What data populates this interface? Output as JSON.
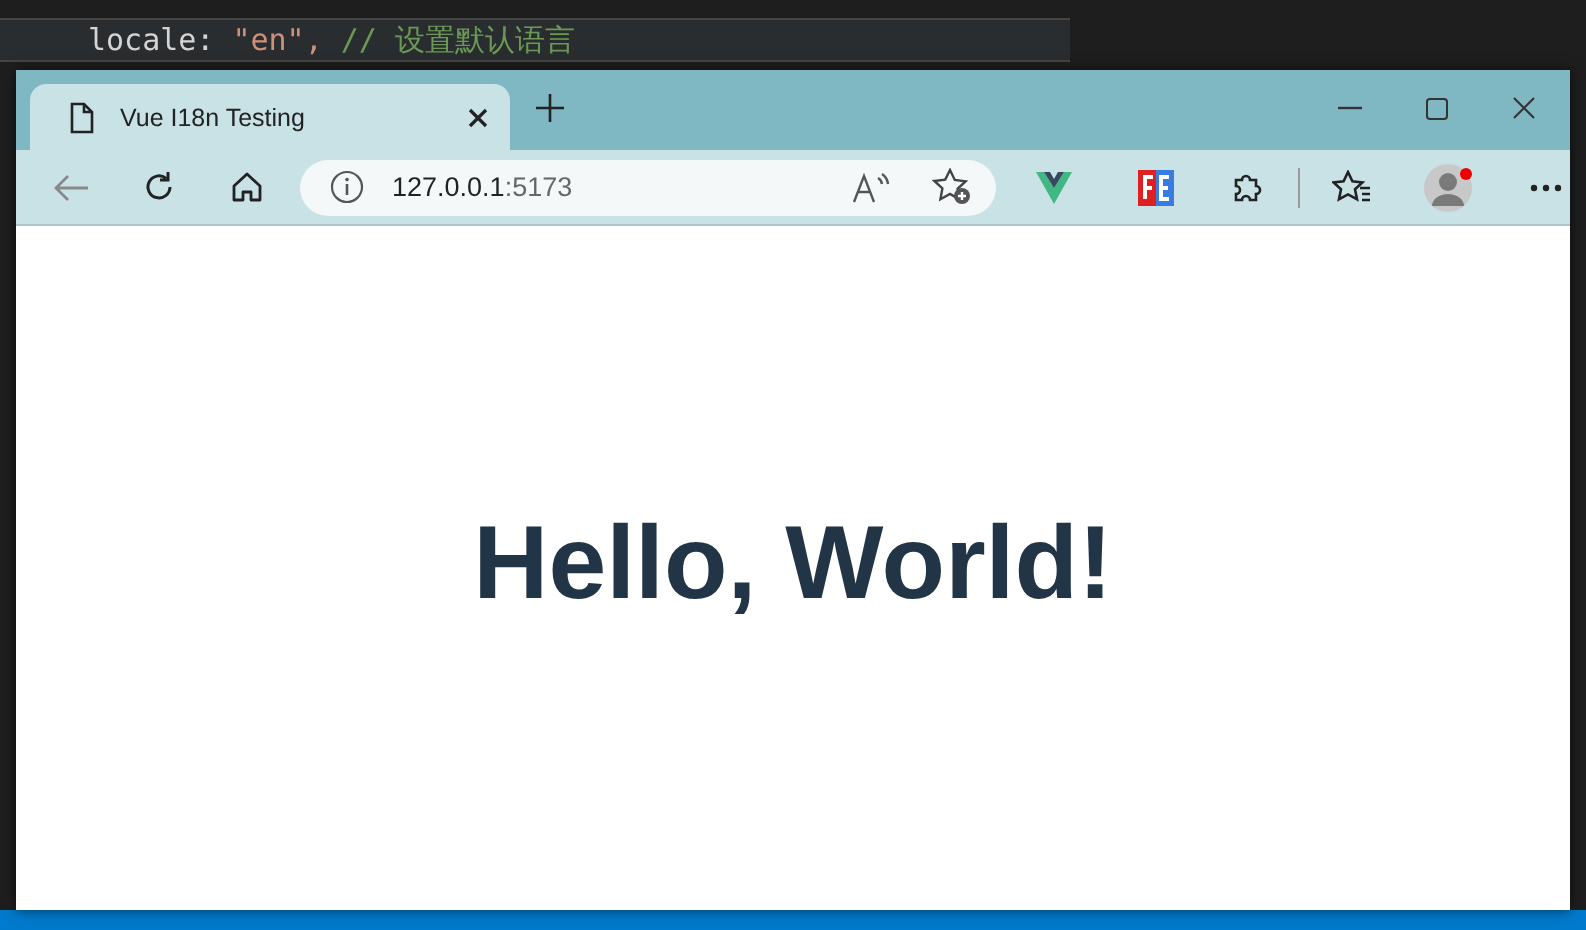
{
  "editor": {
    "code_line": [
      {
        "kind": "property",
        "text": "locale:"
      },
      {
        "kind": "string",
        "text": "\"en\","
      },
      {
        "kind": "comment",
        "text": "// 设置默认语言"
      }
    ]
  },
  "browser": {
    "tabs": [
      {
        "title": "Vue I18n Testing",
        "selected": true
      }
    ],
    "address": {
      "host": "127.0.0.1",
      "port": ":5173"
    }
  },
  "page": {
    "heading": "Hello, World!"
  }
}
